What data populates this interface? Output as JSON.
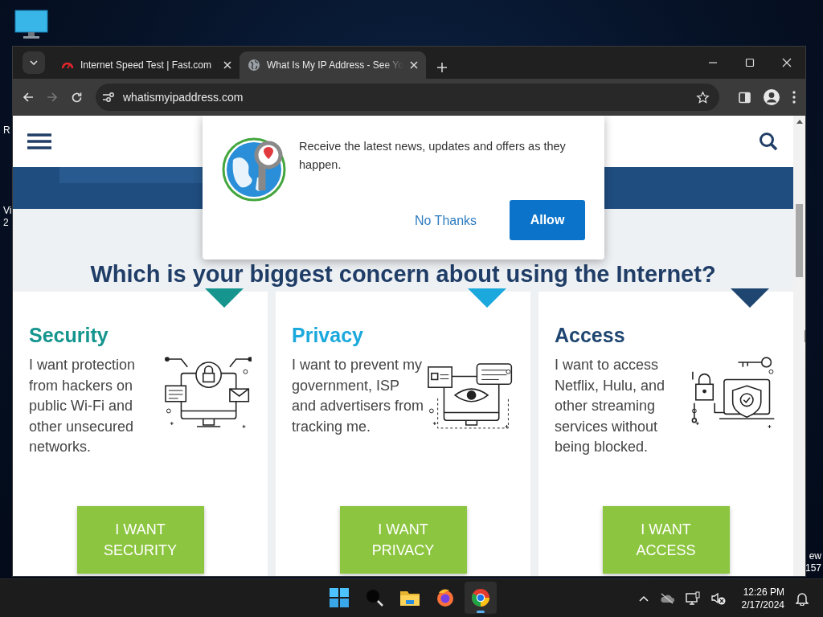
{
  "desktop": {
    "left_labels": [
      "R",
      "Vi",
      "2"
    ],
    "right_labels": [
      "ew",
      "157"
    ]
  },
  "browser": {
    "tabs": [
      {
        "title": "Internet Speed Test | Fast.com",
        "kind": "gauge",
        "selected": false
      },
      {
        "title": "What Is My IP Address - See Yo",
        "kind": "globe",
        "selected": true
      }
    ],
    "address": "whatismyipaddress.com"
  },
  "page": {
    "heading": "Which is your biggest concern about using the Internet?",
    "cards": [
      {
        "kind": "lock",
        "title": "Security",
        "color": "#15958e",
        "text": "I want protection from hackers on public Wi-Fi and other unsecured networks.",
        "button": "I WANT SECURITY"
      },
      {
        "kind": "eye",
        "title": "Privacy",
        "color": "#1ba8dc",
        "text": "I want to prevent my government, ISP and advertisers from tracking me.",
        "button": "I WANT PRIVACY"
      },
      {
        "kind": "shield",
        "title": "Access",
        "color": "#1e4670",
        "text": "I want to access Netflix, Hulu, and other streaming services without being blocked.",
        "button": "I WANT ACCESS"
      }
    ]
  },
  "popup": {
    "message": "Receive the latest news, updates and offers as they happen.",
    "decline": "No Thanks",
    "accept": "Allow"
  },
  "taskbar": {
    "apps": [
      {
        "kind": "start",
        "selected": false
      },
      {
        "kind": "search",
        "selected": false
      },
      {
        "kind": "folder",
        "selected": false
      },
      {
        "kind": "firefox",
        "selected": false
      },
      {
        "kind": "chrome",
        "selected": true
      }
    ],
    "time": "12:26 PM",
    "date": "2/17/2024"
  }
}
